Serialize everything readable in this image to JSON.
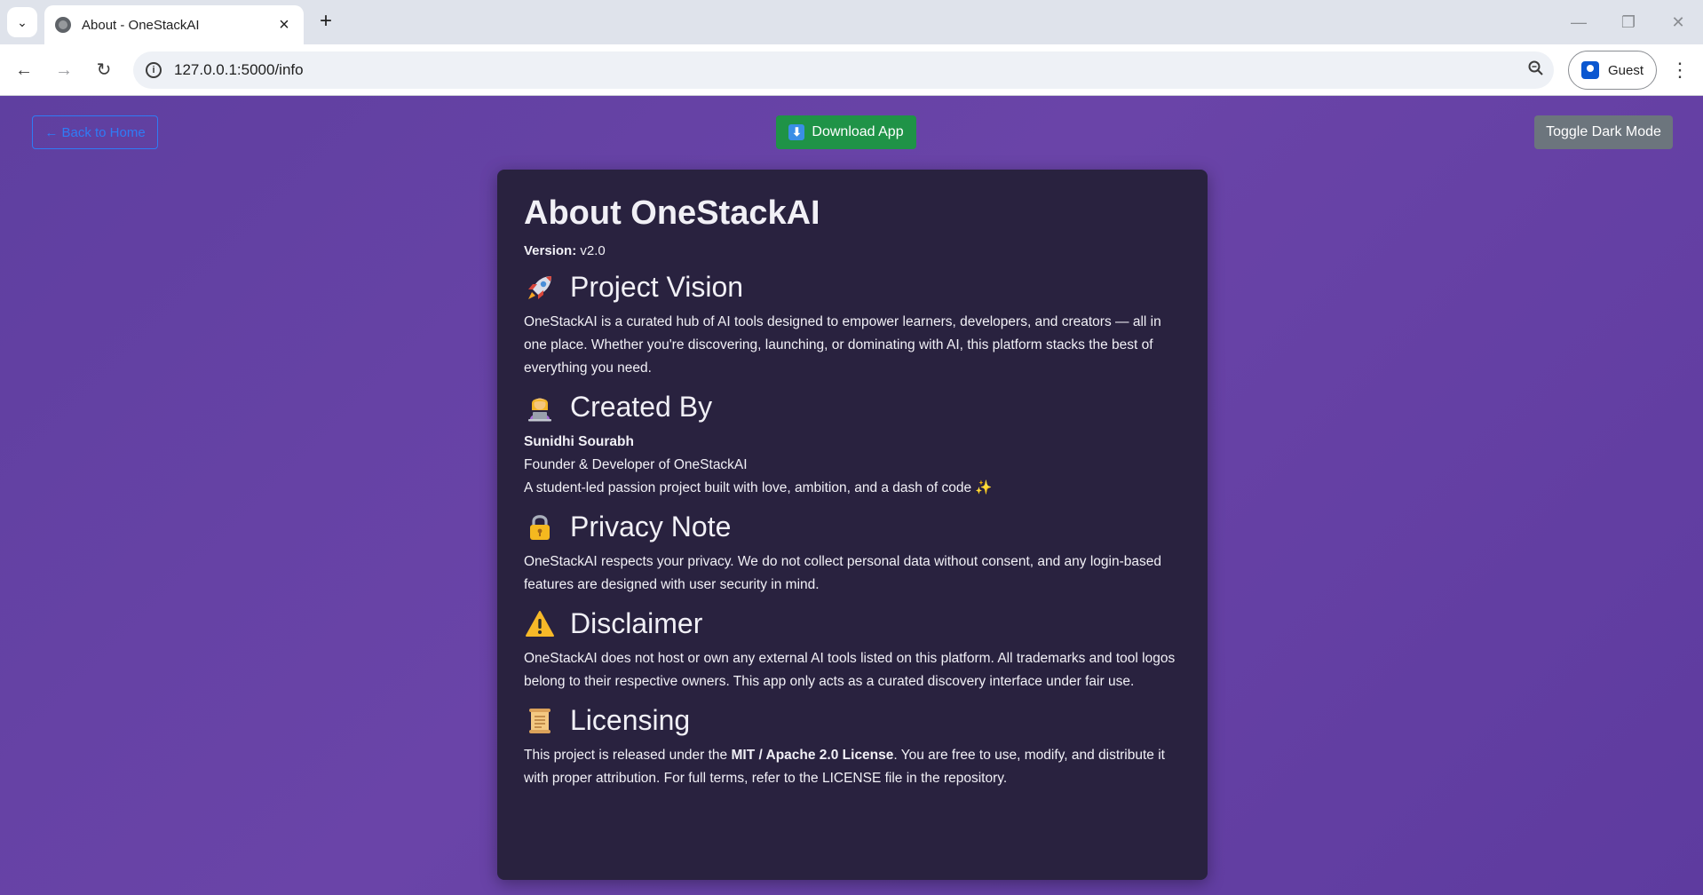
{
  "browser": {
    "tab_title": "About - OneStackAI",
    "url": "127.0.0.1:5000/info",
    "profile_label": "Guest"
  },
  "nav": {
    "back_home": "← Back to Home",
    "download": "Download App",
    "toggle_dark": "Toggle Dark Mode"
  },
  "about": {
    "title": "About OneStackAI",
    "version_label": "Version:",
    "version_value": "v2.0",
    "sections": [
      {
        "icon": "rocket-icon",
        "heading": "Project Vision",
        "text": "OneStackAI is a curated hub of AI tools designed to empower learners, developers, and creators — all in one place. Whether you're discovering, launching, or dominating with AI, this platform stacks the best of everything you need."
      },
      {
        "icon": "technologist-icon",
        "heading": "Created By",
        "name": "Sunidhi Sourabh",
        "role": "Founder & Developer of OneStackAI",
        "text": "A student-led passion project built with love, ambition, and a dash of code ✨"
      },
      {
        "icon": "lock-icon",
        "heading": "Privacy Note",
        "text": "OneStackAI respects your privacy. We do not collect personal data without consent, and any login-based features are designed with user security in mind."
      },
      {
        "icon": "warning-icon",
        "heading": "Disclaimer",
        "text": "OneStackAI does not host or own any external AI tools listed on this platform. All trademarks and tool logos belong to their respective owners. This app only acts as a curated discovery interface under fair use."
      },
      {
        "icon": "scroll-icon",
        "heading": "Licensing",
        "text_before": "This project is released under the ",
        "license": "MIT / Apache 2.0 License",
        "text_after": ". You are free to use, modify, and distribute it with proper attribution. For full terms, refer to the LICENSE file in the repository."
      }
    ]
  },
  "colors": {
    "page_bg": "#6a44a8",
    "card_bg": "#29223f",
    "download_bg": "#1f9347",
    "toggle_bg": "#6c757d",
    "link_blue": "#2f7cf6"
  }
}
